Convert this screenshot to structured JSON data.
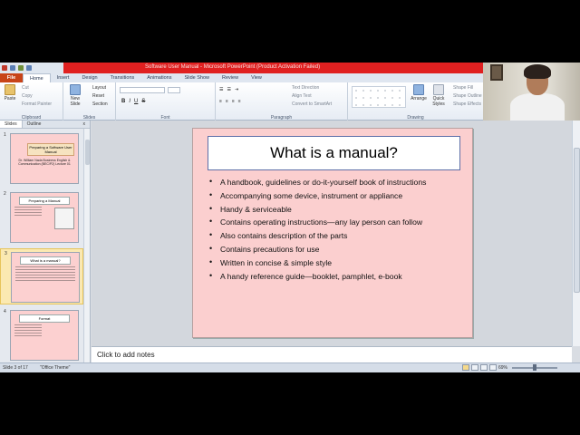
{
  "titlebar": {
    "title": "Software User Manual - Microsoft PowerPoint (Product Activation Failed)"
  },
  "ribbon_tabs": [
    "File",
    "Home",
    "Insert",
    "Design",
    "Transitions",
    "Animations",
    "Slide Show",
    "Review",
    "View"
  ],
  "ribbon": {
    "clipboard": {
      "paste": "Paste",
      "cut": "Cut",
      "copy": "Copy",
      "format_painter": "Format Painter",
      "label": "Clipboard"
    },
    "slides": {
      "new_slide": "New Slide",
      "layout": "Layout",
      "reset": "Reset",
      "section": "Section",
      "label": "Slides"
    },
    "font": {
      "bold": "B",
      "italic": "I",
      "underline": "U",
      "strike": "S",
      "label": "Font"
    },
    "paragraph": {
      "text_direction": "Text Direction",
      "align_text": "Align Text",
      "convert_smartart": "Convert to SmartArt",
      "label": "Paragraph"
    },
    "drawing": {
      "arrange": "Arrange",
      "quick_styles": "Quick Styles",
      "shape_fill": "Shape Fill",
      "shape_outline": "Shape Outline",
      "shape_effects": "Shape Effects",
      "label": "Drawing"
    }
  },
  "left_pane": {
    "tabs": [
      "Slides",
      "Outline"
    ],
    "close": "x",
    "thumbnails": [
      {
        "num": "1",
        "title": "Preparing a Software User Manual",
        "sub": "Dr. William Nada Business English & Communication (BEC/P2) Lecture 01"
      },
      {
        "num": "2",
        "title": "Preparing a Manual"
      },
      {
        "num": "3",
        "title": "What is a manual?"
      },
      {
        "num": "4",
        "title": "Format"
      }
    ]
  },
  "slide": {
    "title": "What is a manual?",
    "bullets": [
      "A handbook, guidelines or do-it-yourself book of instructions",
      "Accompanying some device, instrument or appliance",
      "Handy & serviceable",
      "Contains operating instructions—any lay person can follow",
      "Also contains description of the parts",
      "Contains precautions for use",
      "Written in concise & simple style",
      "A handy reference guide—booklet, pamphlet, e-book"
    ]
  },
  "notes": {
    "placeholder": "Click to add notes"
  },
  "status": {
    "slide_info": "Slide 3 of 17",
    "theme": "\"Office Theme\"",
    "zoom": "69%"
  },
  "colors": {
    "titlebar": "#e02020",
    "file_tab": "#c84418",
    "slide_bg": "#fbcfcf",
    "selected_thumb": "#fbe9b1"
  }
}
